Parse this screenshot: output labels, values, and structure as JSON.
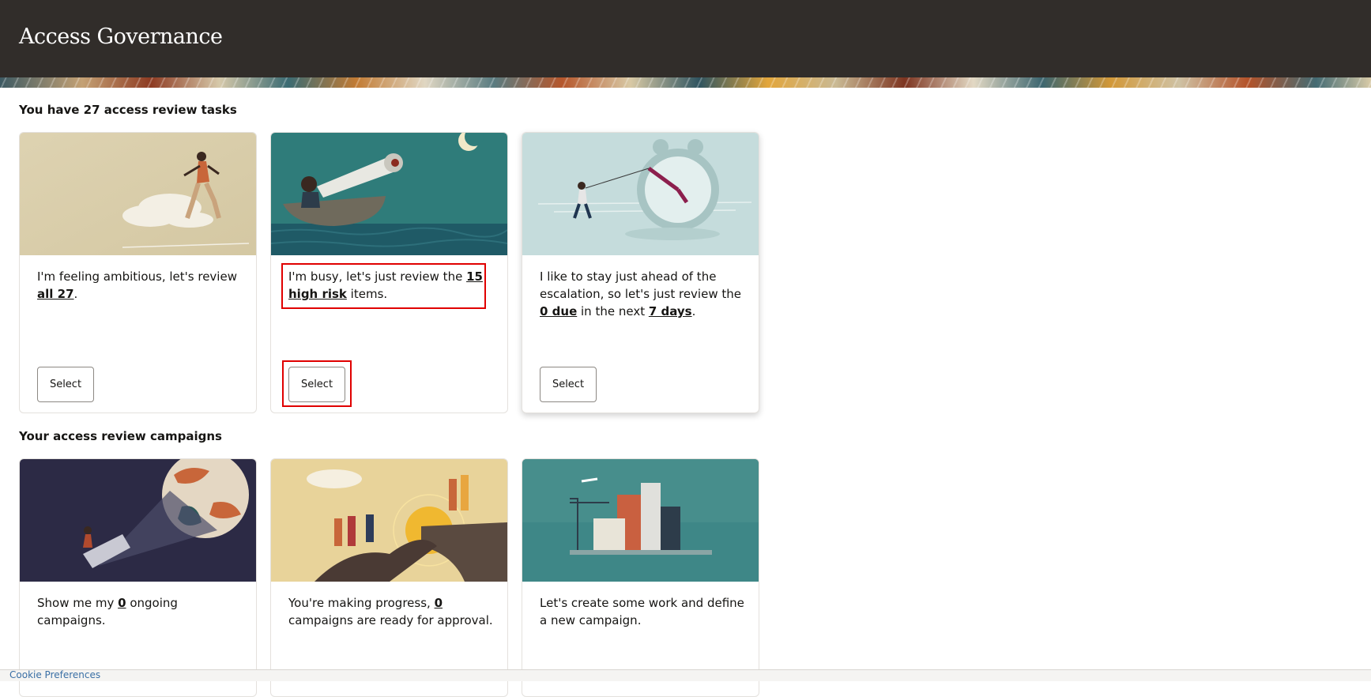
{
  "header": {
    "title": "Access Governance"
  },
  "tasks": {
    "heading": "You have 27 access review tasks",
    "cards": [
      {
        "pre": "I'm feeling ambitious, let's review ",
        "link1": "all 27",
        "post": ".",
        "button": "Select"
      },
      {
        "pre": "I'm busy, let's just review the ",
        "link1": "15 high risk",
        "post": " items.",
        "button": "Select"
      },
      {
        "pre": "I like to stay just ahead of the escalation, so let's just review the ",
        "link1": "0 due",
        "mid": " in the next ",
        "link2": "7 days",
        "post": ".",
        "button": "Select"
      }
    ]
  },
  "campaigns": {
    "heading": "Your access review campaigns",
    "cards": [
      {
        "pre": "Show me my ",
        "link1": "0",
        "post": " ongoing campaigns."
      },
      {
        "pre": "You're making progress, ",
        "link1": "0",
        "post": " campaigns are ready for approval."
      },
      {
        "text": "Let's create some work and define a new campaign."
      }
    ]
  },
  "footer": {
    "cookie_link": "Cookie Preferences"
  },
  "colors": {
    "header_bg": "#312d2a",
    "highlight": "#e00000"
  }
}
